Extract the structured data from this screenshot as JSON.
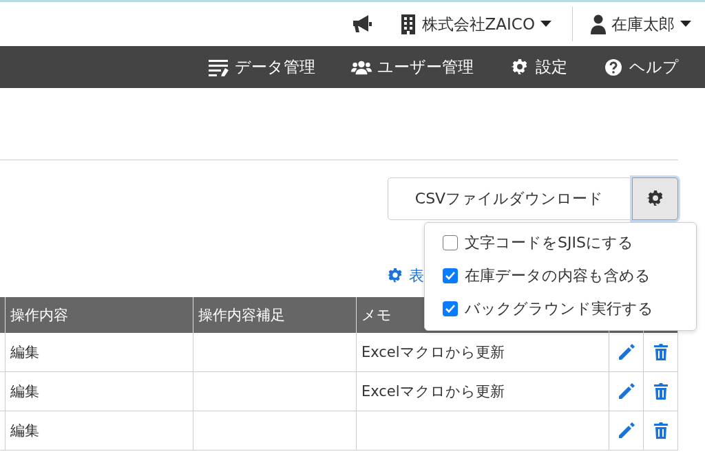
{
  "header": {
    "company": "株式会社ZAICO",
    "user": "在庫太郎"
  },
  "nav": [
    {
      "label": "データ管理",
      "kind": "data"
    },
    {
      "label": "ユーザー管理",
      "kind": "users"
    },
    {
      "label": "設定",
      "kind": "settings"
    },
    {
      "label": "ヘルプ",
      "kind": "help"
    }
  ],
  "csv_button": "CSVファイルダウンロード",
  "csv_options": [
    {
      "label": "文字コードをSJISにする",
      "checked": false
    },
    {
      "label": "在庫データの内容も含める",
      "checked": true
    },
    {
      "label": "バックグラウンド実行する",
      "checked": true
    }
  ],
  "display_settings_link": "表",
  "table": {
    "columns": [
      "操作内容",
      "操作内容補足",
      "メモ"
    ],
    "rows": [
      {
        "cells": [
          "編集",
          "",
          "Excelマクロから更新"
        ]
      },
      {
        "cells": [
          "編集",
          "",
          "Excelマクロから更新"
        ]
      },
      {
        "cells": [
          "編集",
          "",
          ""
        ]
      }
    ]
  }
}
